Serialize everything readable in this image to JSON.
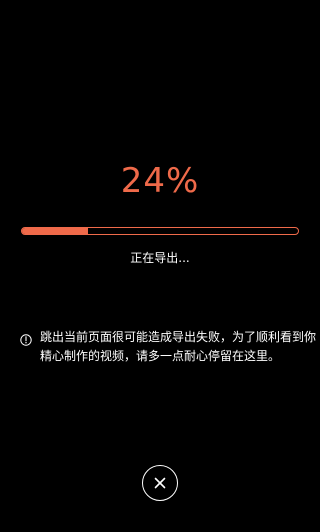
{
  "export": {
    "progress_text": "24%",
    "progress_value": 0.24,
    "status_label": "正在导出...",
    "warning_text": "跳出当前页面很可能造成导出失败，为了顺利看到你精心制作的视频，请多一点耐心停留在这里。",
    "warning_icon": "info-circle-icon",
    "close_icon": "close-icon"
  },
  "colors": {
    "accent": "#ef6a4a",
    "background": "#000000",
    "text": "#ffffff"
  }
}
